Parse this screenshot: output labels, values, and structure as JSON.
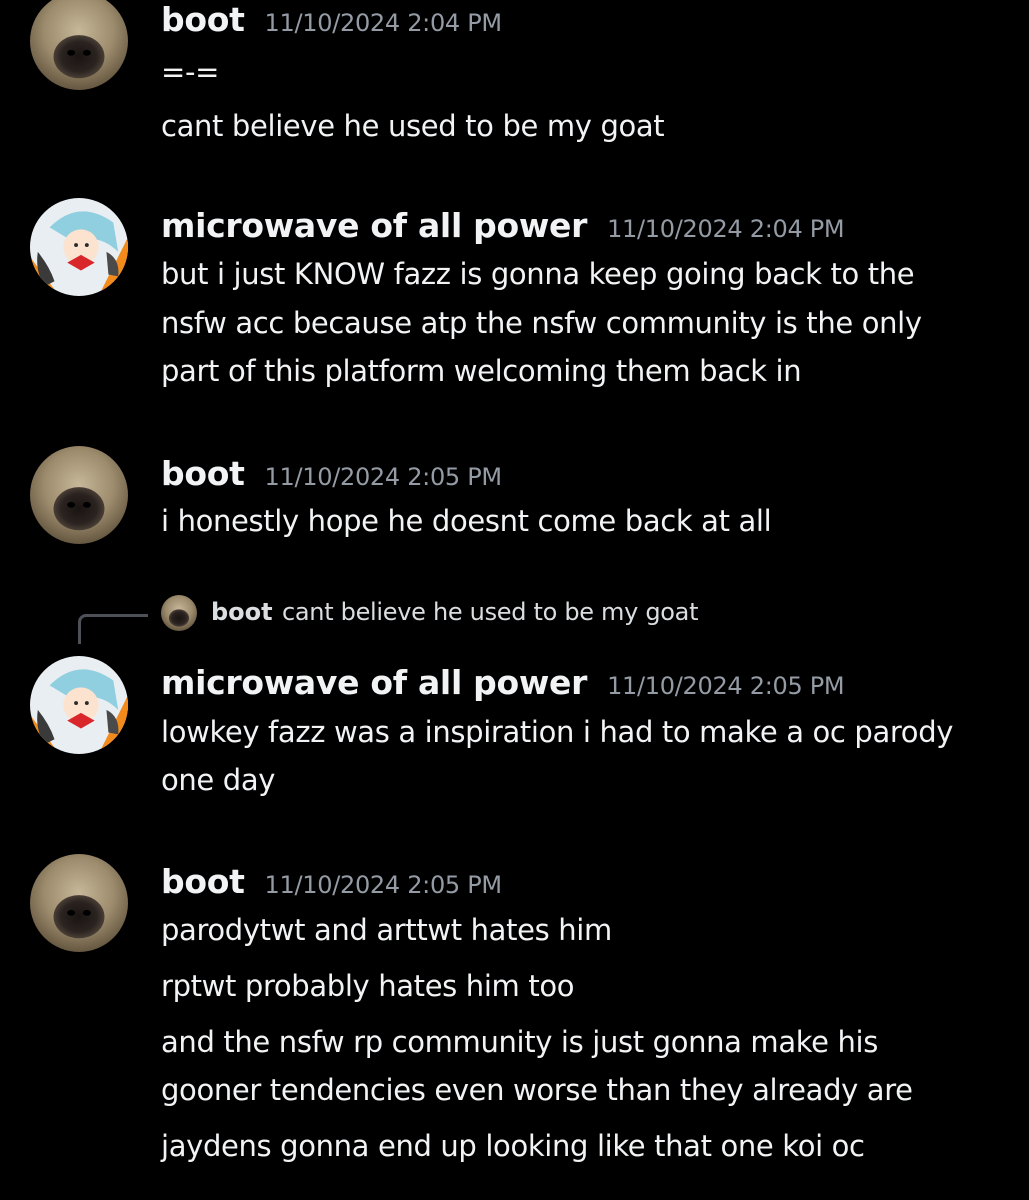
{
  "messages": [
    {
      "author": "boot",
      "timestamp": "11/10/2024 2:04 PM",
      "avatar": "pug-avatar",
      "lines": [
        "=-=",
        "cant believe he used to be my goat"
      ]
    },
    {
      "author": "microwave of all power",
      "timestamp": "11/10/2024 2:04 PM",
      "avatar": "anime-character-avatar",
      "lines": [
        "but i just KNOW fazz is gonna keep going back to the",
        "nsfw acc because atp the nsfw community is the only",
        "part of this platform welcoming them back in"
      ]
    },
    {
      "author": "boot",
      "timestamp": "11/10/2024 2:05 PM",
      "avatar": "pug-avatar",
      "lines": [
        "i honestly hope he doesnt come back at all"
      ]
    },
    {
      "reply": {
        "author": "boot",
        "text": "cant believe he used to be my goat"
      },
      "author": "microwave of all power",
      "timestamp": "11/10/2024 2:05 PM",
      "avatar": "anime-character-avatar",
      "lines": [
        "lowkey fazz was a inspiration i had to make a oc parody",
        "one day"
      ]
    },
    {
      "author": "boot",
      "timestamp": "11/10/2024 2:05 PM",
      "avatar": "pug-avatar",
      "lines": [
        "parodytwt and arttwt hates him",
        "rptwt probably hates him too",
        "and the nsfw rp community is just gonna make his",
        "gooner tendencies even worse than they already are",
        "jaydens gonna end up looking like that one koi oc"
      ]
    }
  ],
  "colors": {
    "background": "#000000",
    "text": "#f2f3f5",
    "timestamp": "#949ba4",
    "reply_line": "#4e5058"
  }
}
